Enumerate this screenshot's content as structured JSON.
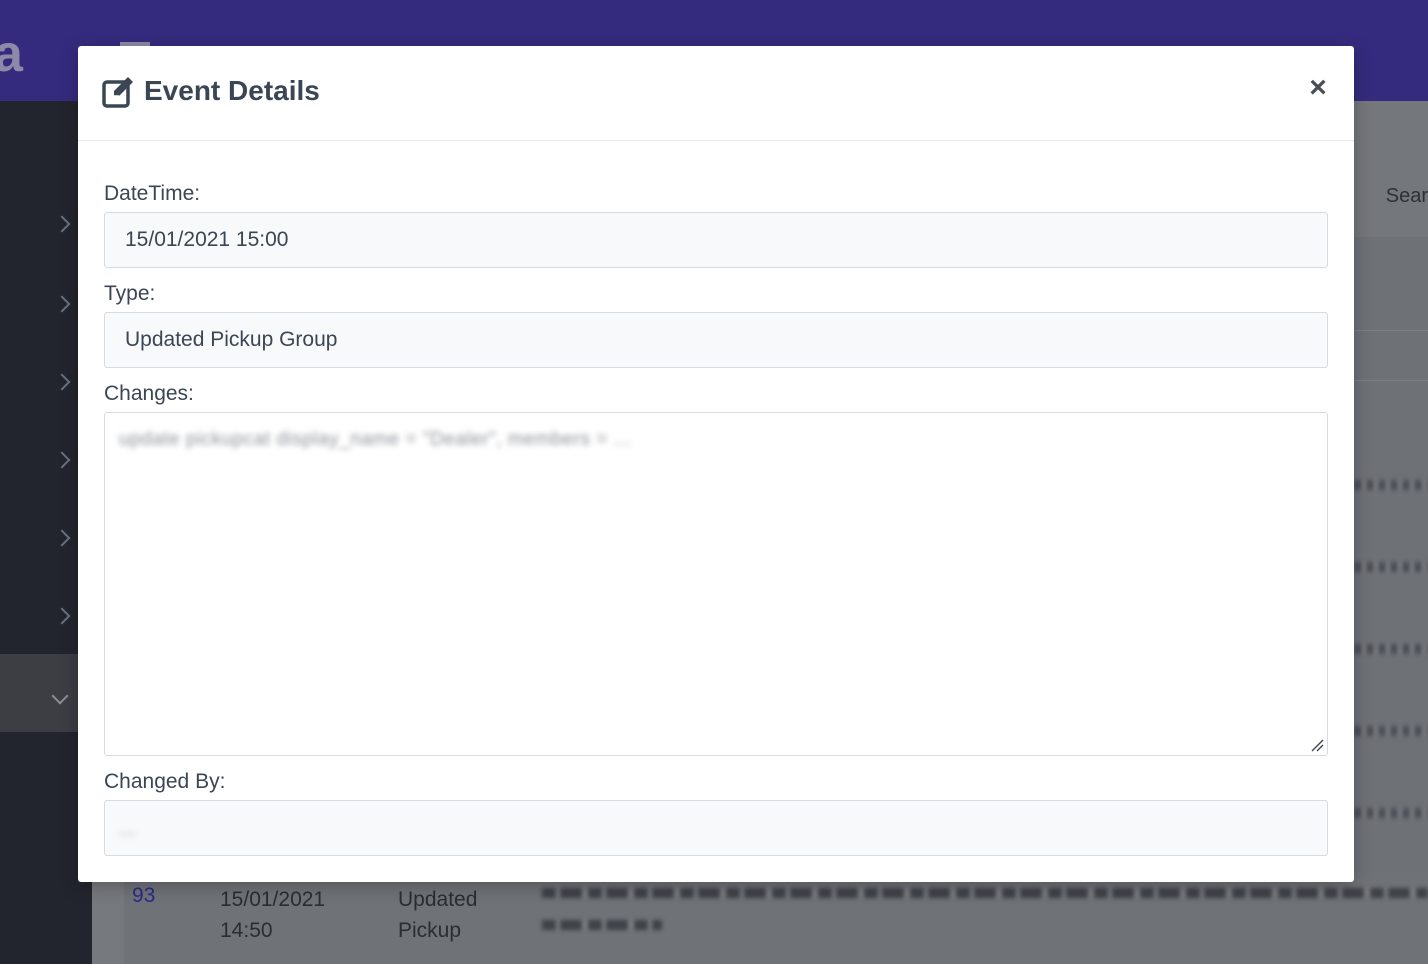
{
  "background": {
    "search_label": "Sear",
    "brand_letter": "a",
    "row": {
      "id": "93",
      "datetime": "15/01/2021 14:50",
      "type": "Updated Pickup",
      "changes": "update pickupcat display_name = \"Dealer\", members = ..."
    }
  },
  "modal": {
    "title": "Event Details",
    "icon": "edit-icon",
    "close_label": "×",
    "fields": {
      "datetime_label": "DateTime:",
      "datetime_value": "15/01/2021 15:00",
      "type_label": "Type:",
      "type_value": "Updated Pickup Group",
      "changes_label": "Changes:",
      "changes_value": "update pickupcat display_name = \"Dealer\", members = ...",
      "changed_by_label": "Changed By:",
      "changed_by_value": "..."
    }
  },
  "colors": {
    "topbar": "#352b7e",
    "sidebar": "#22252d",
    "title_text": "#3b4654",
    "link": "#2a2a8a"
  }
}
